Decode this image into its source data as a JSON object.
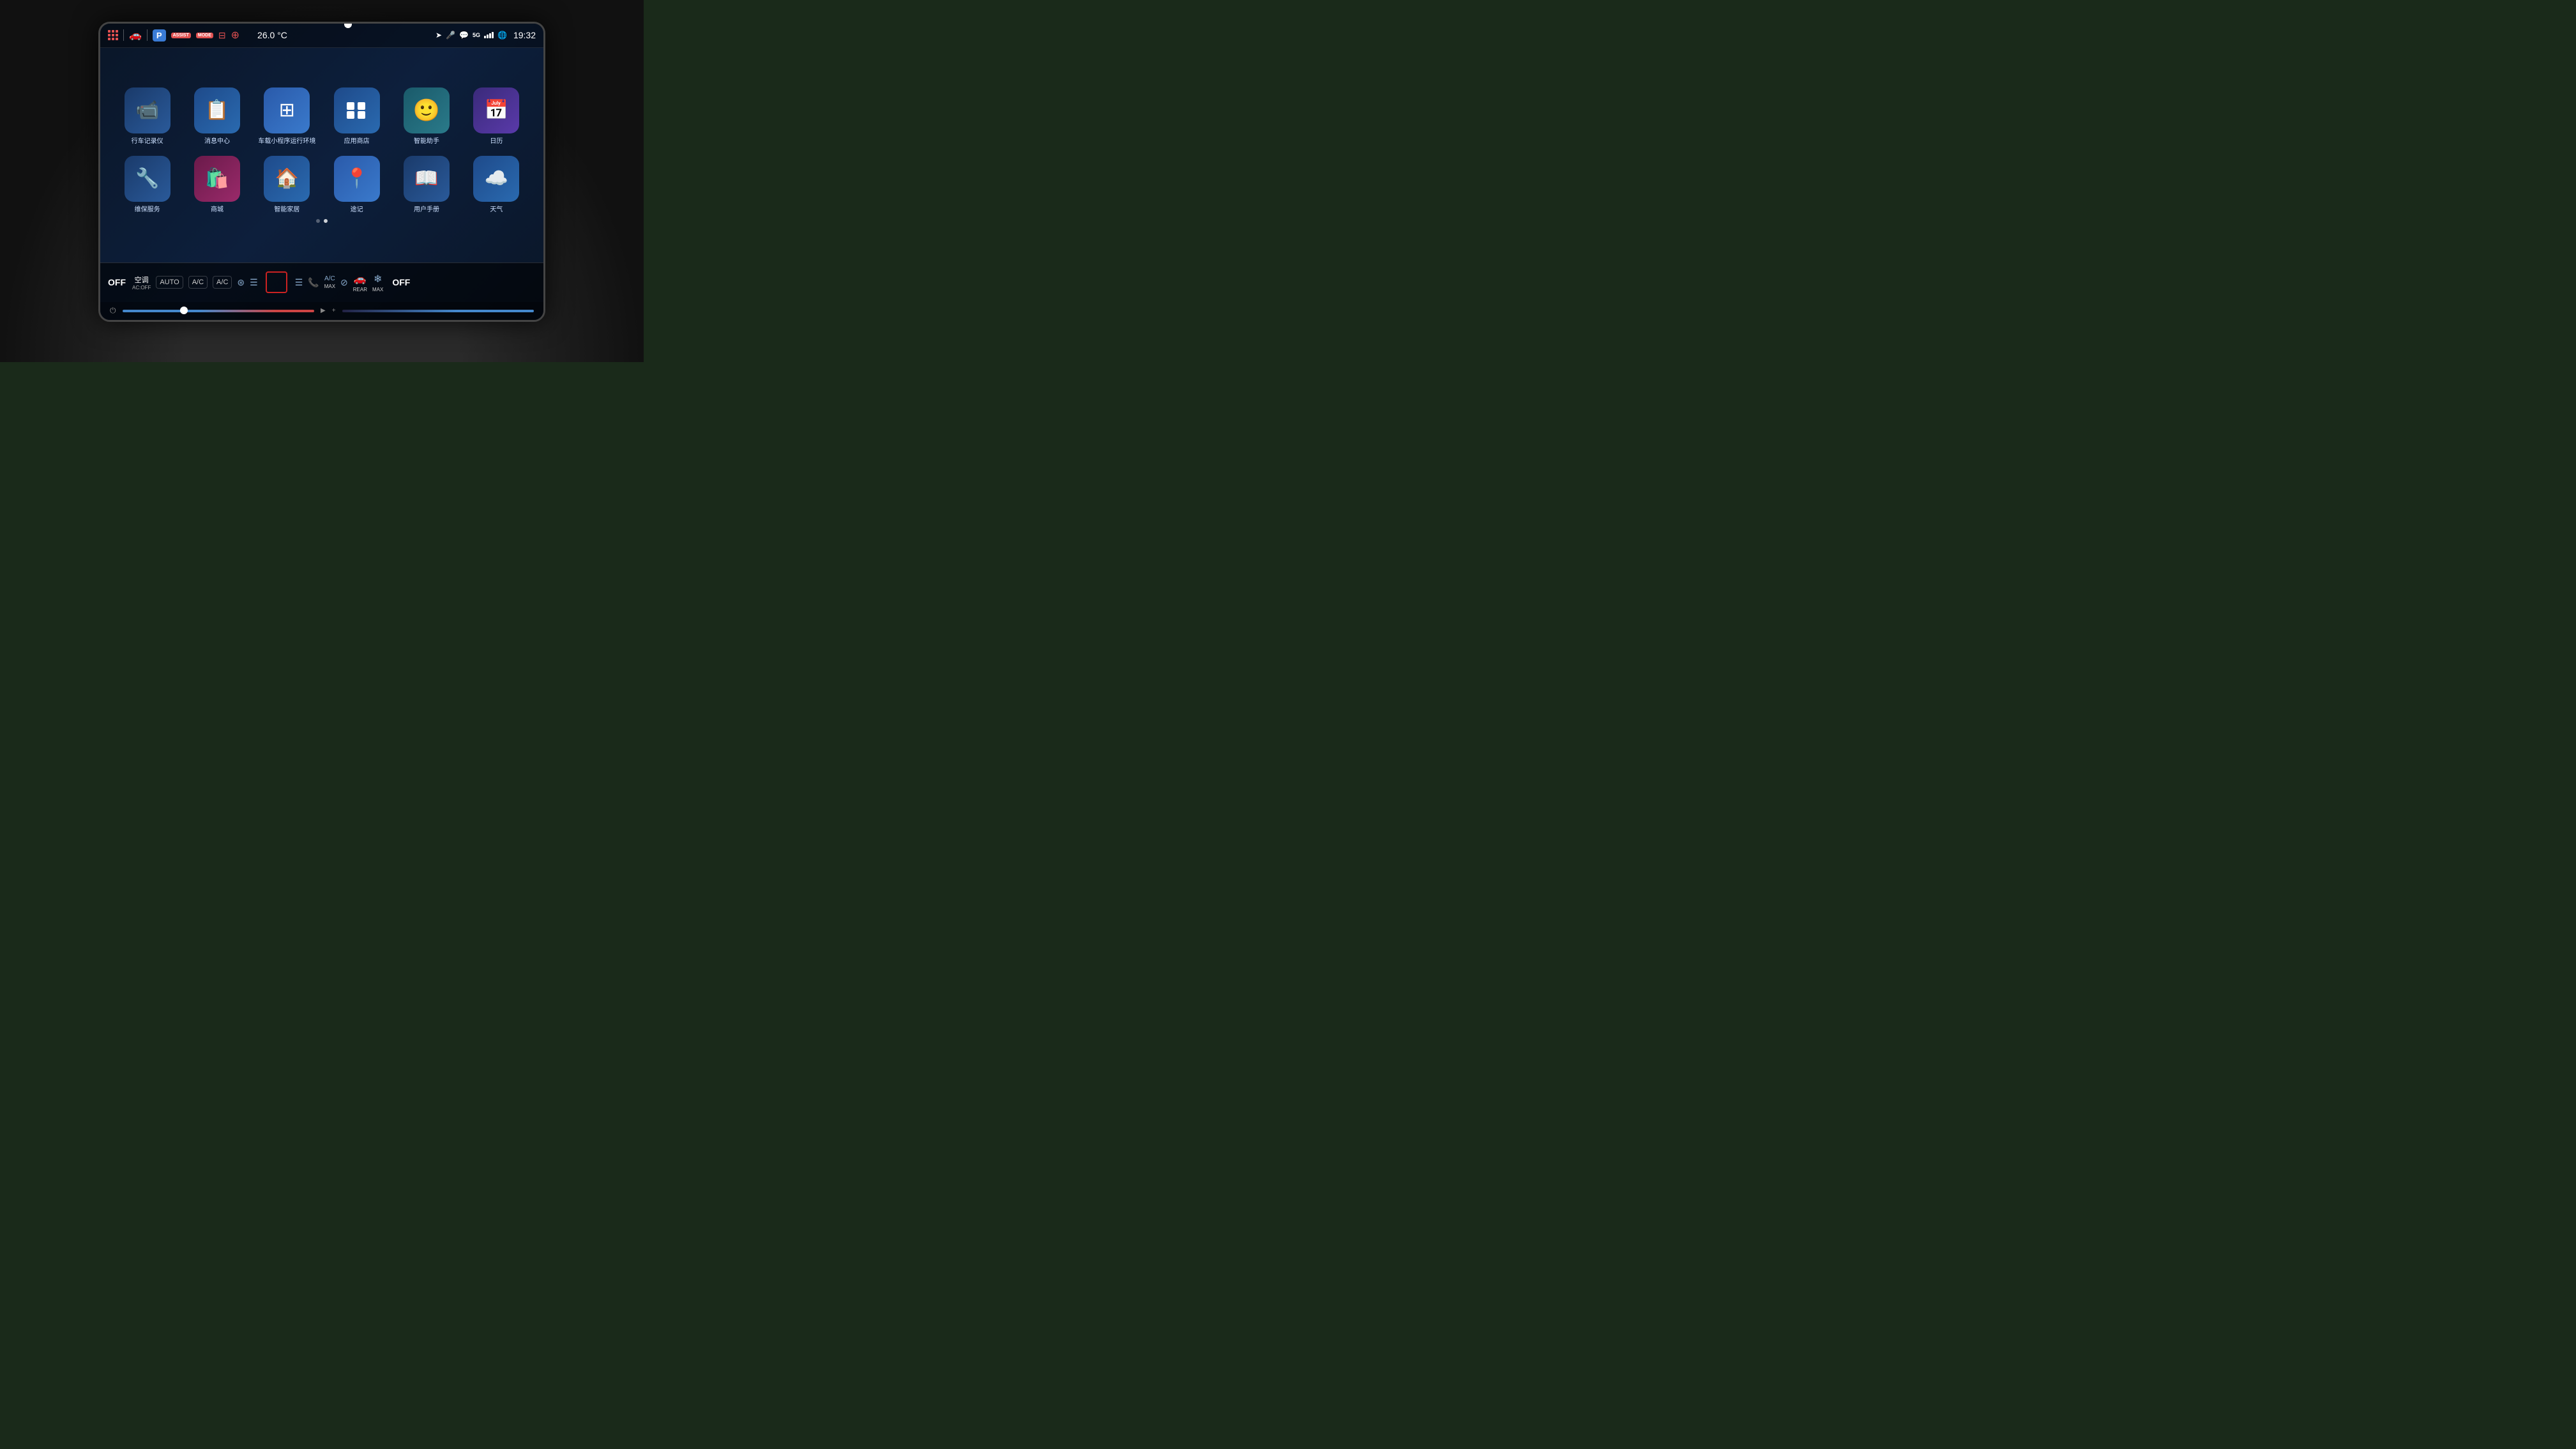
{
  "screen": {
    "statusBar": {
      "temperature": "26.0 °C",
      "time": "19:32",
      "parkingBadge": "P",
      "assistLabel": "ASSIST",
      "modeLabel": "MODE"
    },
    "apps": [
      {
        "id": "dashcam",
        "label": "行车记录仪",
        "icon": "📹",
        "colorClass": "blue-dark"
      },
      {
        "id": "message",
        "label": "消息中心",
        "icon": "📋",
        "colorClass": "blue-mid"
      },
      {
        "id": "miniapp",
        "label": "车载小程序运行环境",
        "icon": "⊞",
        "colorClass": "blue-bright"
      },
      {
        "id": "appstore",
        "label": "应用商店",
        "icon": "⊞",
        "colorClass": "blue-mid"
      },
      {
        "id": "assistant",
        "label": "智能助手",
        "icon": "☺",
        "colorClass": "teal"
      },
      {
        "id": "calendar",
        "label": "日历",
        "icon": "📅",
        "colorClass": "purple"
      },
      {
        "id": "maintenance",
        "label": "维保服务",
        "icon": "🔧",
        "colorClass": "blue-dark"
      },
      {
        "id": "shop",
        "label": "商城",
        "icon": "🛍",
        "colorClass": "pink"
      },
      {
        "id": "smarthome",
        "label": "智能家居",
        "icon": "🏠",
        "colorClass": "blue-mid"
      },
      {
        "id": "trips",
        "label": "途记",
        "icon": "📍",
        "colorClass": "blue-bright"
      },
      {
        "id": "manual",
        "label": "用户手册",
        "icon": "📖",
        "colorClass": "blue-dark"
      },
      {
        "id": "weather",
        "label": "天气",
        "icon": "☁",
        "colorClass": "blue-mid"
      }
    ],
    "pagination": {
      "current": 1,
      "total": 2
    },
    "climate": {
      "leftOff": "OFF",
      "acLabel": "空调",
      "acSubLabel": "AC:OFF",
      "autoLabel": "AUTO",
      "acBtn1": "A/C",
      "acBtn2": "A/C",
      "rightOff": "OFF",
      "rearLabel": "REAR",
      "maxLabel": "MAX"
    }
  }
}
